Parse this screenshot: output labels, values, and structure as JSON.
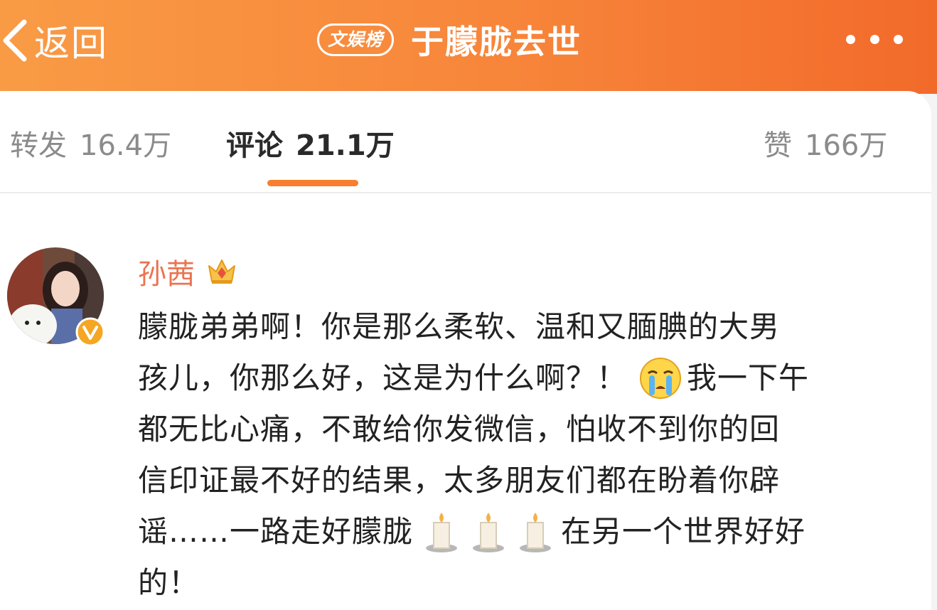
{
  "header": {
    "back_label": "返回",
    "badge": "文娱榜",
    "title": "于朦胧去世"
  },
  "tabs": {
    "repost": {
      "label": "转发",
      "count": "16.4万"
    },
    "comment": {
      "label": "评论",
      "count": "21.1万"
    },
    "like": {
      "label": "赞",
      "count": "166万"
    }
  },
  "comment": {
    "username": "孙茜",
    "lines": [
      [
        "朦胧弟弟啊！你是那么柔软、温和又腼腆的大男"
      ],
      [
        "孩儿，你那么好，这是为什么啊？！",
        "我一下午"
      ],
      [
        "都无比心痛，不敢给你发微信，怕收不到你的回"
      ],
      [
        "信印证最不好的结果，太多朋友们都在盼着你辟"
      ],
      [
        "谣……一路走好朦胧",
        "在另一个世界好好"
      ],
      [
        "的！"
      ]
    ],
    "emojis": {
      "crying": "crying-emoji",
      "candle": "candle-emoji"
    }
  },
  "colors": {
    "accent": "#f77f2f",
    "username": "#eb7350",
    "header_start": "#f99b45",
    "header_end": "#f26a2a"
  }
}
